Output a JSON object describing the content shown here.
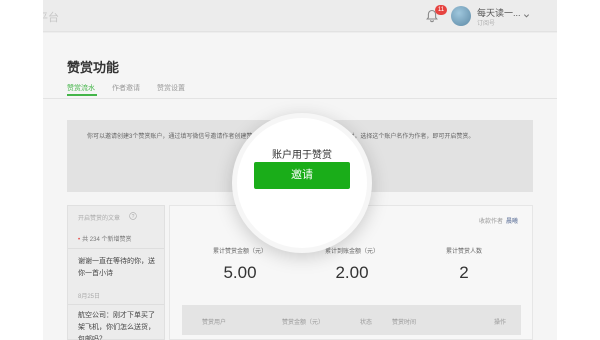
{
  "topbar": {
    "platform_fragment": "平台",
    "notification_count": "11",
    "account_name": "每天读一...",
    "account_type": "订阅号"
  },
  "page": {
    "title": "赞赏功能",
    "tabs": [
      {
        "label": "赞赏流水",
        "active": true
      },
      {
        "label": "作者邀请",
        "active": false
      },
      {
        "label": "赞赏设置",
        "active": false
      }
    ]
  },
  "invite": {
    "description": "你可以邀请创建3个赞赏账户，通过填写微信号邀请作者创建赞赏账户用于赞赏。你在文章声明原创时，选择这个账户名作为作者，即可开启赞赏。",
    "spotlight_text": "账户用于赞赏",
    "button_label": "邀请"
  },
  "left_panel": {
    "header": "开启赞赏的文章",
    "new_count": "共 234 个新增赞赏",
    "message_1": "谢谢一直在等待的你，送你一首小诗",
    "date": "8月25日",
    "message_2": "航空公司：刚才下单买了架飞机，你们怎么送货，包邮吗？"
  },
  "right_panel": {
    "receiver_label": "收款作者",
    "receiver_name": "晨曦",
    "stats": [
      {
        "label": "累计赞赏金额（元）",
        "value": "5.00"
      },
      {
        "label": "累计到账金额（元）",
        "value": "2.00"
      },
      {
        "label": "累计赞赏人数",
        "value": "2"
      }
    ],
    "table_headers": [
      "赞赏用户",
      "赞赏金额（元）",
      "状态",
      "赞赏时间",
      "操作"
    ]
  },
  "colors": {
    "accent_green": "#44b549",
    "button_green": "#1aad19",
    "badge_red": "#e64340",
    "link_blue": "#576b95"
  }
}
